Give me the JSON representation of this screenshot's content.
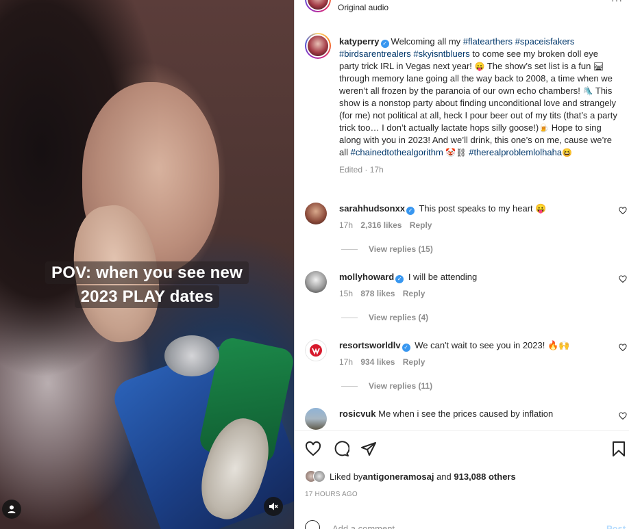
{
  "video": {
    "caption_line1": "POV: when you see new",
    "caption_line2": "2023 PLAY dates"
  },
  "header": {
    "audio_label": "Original audio"
  },
  "post": {
    "username": "katyperry",
    "text_1": "Welcoming all my ",
    "tag_1": "#flatearthers",
    "tag_2": "#spaceisfakers",
    "tag_3": "#birdsarentrealers",
    "tag_4": "#skyisntbluers",
    "text_2": " to come see my broken doll eye party trick IRL in Vegas next year! ",
    "text_3": " The show’s set list is a fun ",
    "text_4": " through memory lane going all the way back to 2008, a time when we weren’t all frozen by the paranoia of our own echo chambers! ",
    "text_5": " This show is a nonstop party about finding unconditional love and strangely (for me) not political at all, heck I pour beer out of my tits (that’s a party trick too… I don’t actually lactate hops silly goose!)",
    "text_6": " Hope to sing along with you in 2023! And we’ll drink, this one’s on me, cause we’re all ",
    "tag_5": "#chainedtothealgorithm",
    "tag_6": "#therealproblemlolhaha",
    "emoji_1": "😛",
    "emoji_2": "🛤",
    "emoji_3": "🛝",
    "emoji_4": "🍺",
    "emoji_5": "🤡",
    "emoji_6": "⛓",
    "emoji_7": "😆",
    "edited": "Edited · 17h"
  },
  "comments": [
    {
      "username": "sarahhudsonxx",
      "text": "This post speaks to my heart 😛",
      "time": "17h",
      "likes": "2,316 likes",
      "reply": "Reply",
      "view_replies": "View replies (15)"
    },
    {
      "username": "mollyhoward",
      "text": "I will be attending",
      "time": "15h",
      "likes": "878 likes",
      "reply": "Reply",
      "view_replies": "View replies (4)"
    },
    {
      "username": "resortsworldlv",
      "text": "We can't wait to see you in 2023! 🔥🙌",
      "time": "17h",
      "likes": "934 likes",
      "reply": "Reply",
      "view_replies": "View replies (11)"
    },
    {
      "username": "rosicvuk",
      "text": "Me when i see the prices caused by inflation"
    }
  ],
  "likes": {
    "prefix": "Liked by ",
    "user": "antigoneramosaj",
    "middle": " and ",
    "count": "913,088 others"
  },
  "timestamp": "17 HOURS AGO",
  "add_comment": {
    "placeholder": "Add a comment…",
    "post_label": "Post"
  },
  "colors": {
    "link": "#00376b",
    "verified": "#3897f0",
    "muted": "#8e8e8e"
  },
  "icons": {
    "like": "heart-icon",
    "comment": "comment-icon",
    "share": "paper-plane-icon",
    "save": "bookmark-icon",
    "mute": "muted-speaker-icon",
    "user": "user-tag-icon"
  }
}
